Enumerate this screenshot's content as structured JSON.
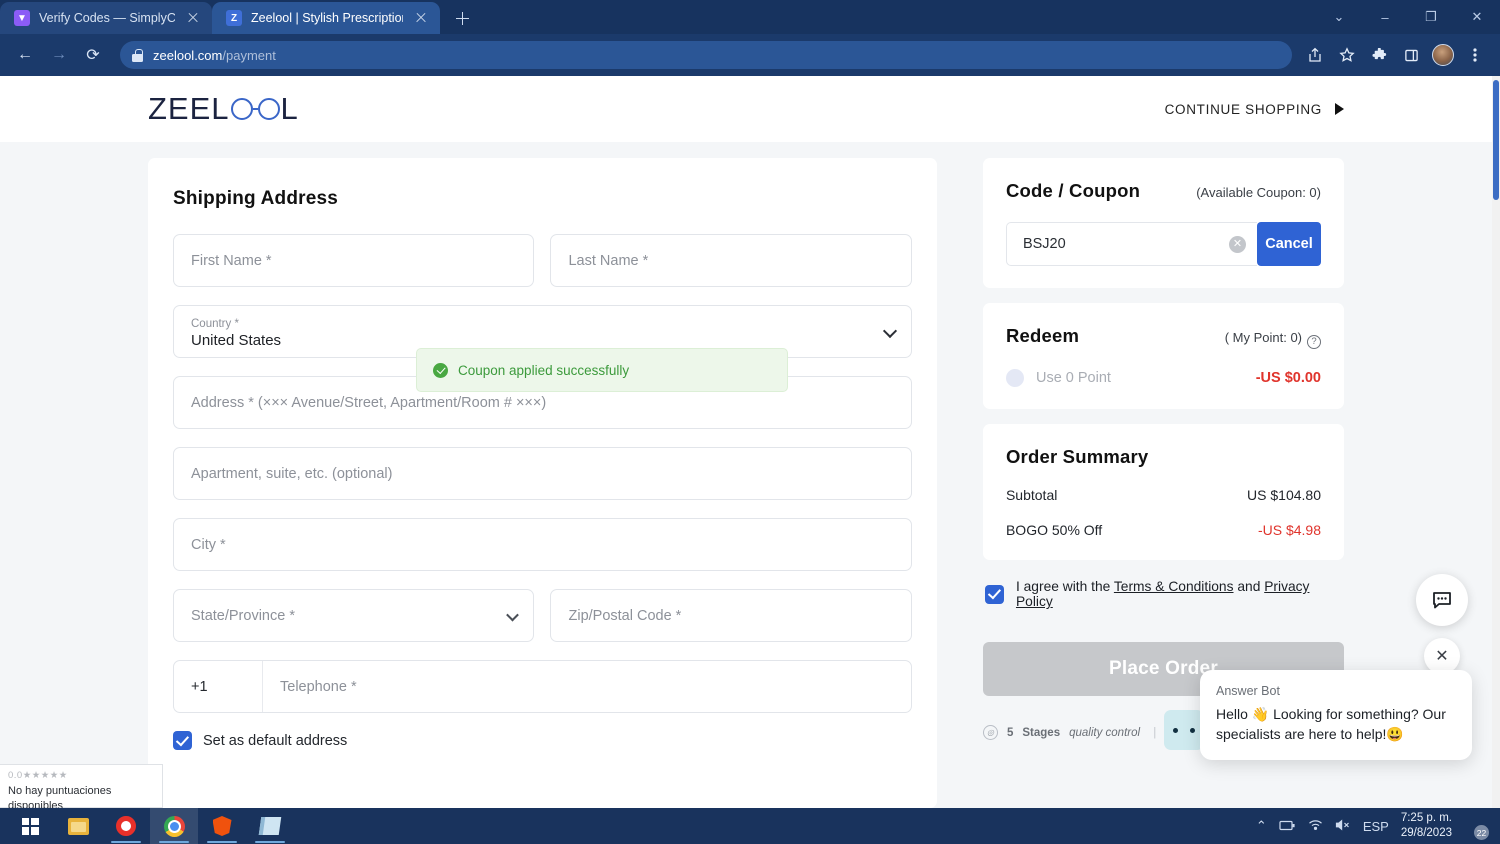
{
  "browser": {
    "tabs": [
      {
        "title": "Verify Codes — SimplyCodes",
        "favicon": "simplycodes-favicon",
        "favicon_letter": "▼",
        "active": false
      },
      {
        "title": "Zeelool | Stylish Prescription Glas",
        "favicon": "zeelool-favicon",
        "favicon_letter": "Z",
        "active": true
      }
    ],
    "new_tab_label": "+",
    "window_controls": {
      "minimize_group": "⌄",
      "minimize": "–",
      "maximize": "❐",
      "close": "✕"
    },
    "nav": {
      "back": "←",
      "forward": "→",
      "reload": "⟳"
    },
    "url_host": "zeelool.com",
    "url_path": "/payment",
    "toolbar_icons": [
      "share-icon",
      "bookmark-star-icon",
      "extensions-puzzle-icon",
      "side-panel-icon",
      "profile-avatar",
      "chrome-menu-icon"
    ]
  },
  "site": {
    "logo": {
      "text_before": "ZEEL",
      "text_after": "L"
    },
    "continue_shopping": "CONTINUE SHOPPING"
  },
  "shipping": {
    "title": "Shipping Address",
    "first_name_placeholder": "First Name *",
    "last_name_placeholder": "Last Name *",
    "country_label": "Country *",
    "country_value": "United States",
    "address_placeholder": "Address * (××× Avenue/Street, Apartment/Room # ×××)",
    "apartment_placeholder": "Apartment, suite, etc. (optional)",
    "city_placeholder": "City *",
    "state_placeholder": "State/Province *",
    "zip_placeholder": "Zip/Postal Code *",
    "country_code": "+1",
    "telephone_placeholder": "Telephone *",
    "default_address_label": "Set as default address"
  },
  "toast": {
    "message": "Coupon applied successfully"
  },
  "coupon": {
    "title": "Code / Coupon",
    "available": "(Available Coupon: 0)",
    "input_value": "BSJ20",
    "clear_icon": "✕",
    "button_label": "Cancel"
  },
  "redeem": {
    "title": "Redeem",
    "my_point": "( My Point: 0)",
    "help_icon": "?",
    "use_point_label": "Use 0 Point",
    "amount": "-US $0.00"
  },
  "order_summary": {
    "title": "Order Summary",
    "rows": [
      {
        "label": "Subtotal",
        "amount": "US $104.80",
        "negative": false
      },
      {
        "label": "BOGO 50% Off",
        "amount": "-US $4.98",
        "negative": true
      }
    ]
  },
  "agreement": {
    "prefix": "I agree with the ",
    "terms": "Terms & Conditions",
    "middle": " and ",
    "privacy": "Privacy Policy"
  },
  "place_order_label": "Place Order",
  "quality": {
    "badge_1_num": "5",
    "badge_1_bold": "Stages",
    "badge_1_text": "quality control",
    "separator": "|"
  },
  "chat": {
    "bot_name": "Answer Bot",
    "message": "Hello 👋 Looking for something? Our specialists are here to help!😃",
    "close_icon": "✕"
  },
  "rating_widget": {
    "score": "0.0",
    "stars": "★★★★★",
    "text": "No hay puntuaciones disponibles"
  },
  "taskbar": {
    "apps": [
      "windows-start-icon",
      "file-explorer-icon",
      "opera-icon",
      "chrome-icon",
      "brave-icon",
      "sticky-notes-icon"
    ],
    "tray": {
      "chevron": "⌃",
      "battery": "🔋",
      "wifi": "◠",
      "volume": "🔇",
      "language": "ESP"
    },
    "time": "7:25 p. m.",
    "date": "29/8/2023",
    "notification_count": "22"
  },
  "colors": {
    "accent_blue": "#2f63d4",
    "browser_chrome": "#1b3a6b",
    "danger_red": "#e0342c",
    "success_green": "#3c9a3c",
    "page_bg": "#f4f6f8"
  }
}
